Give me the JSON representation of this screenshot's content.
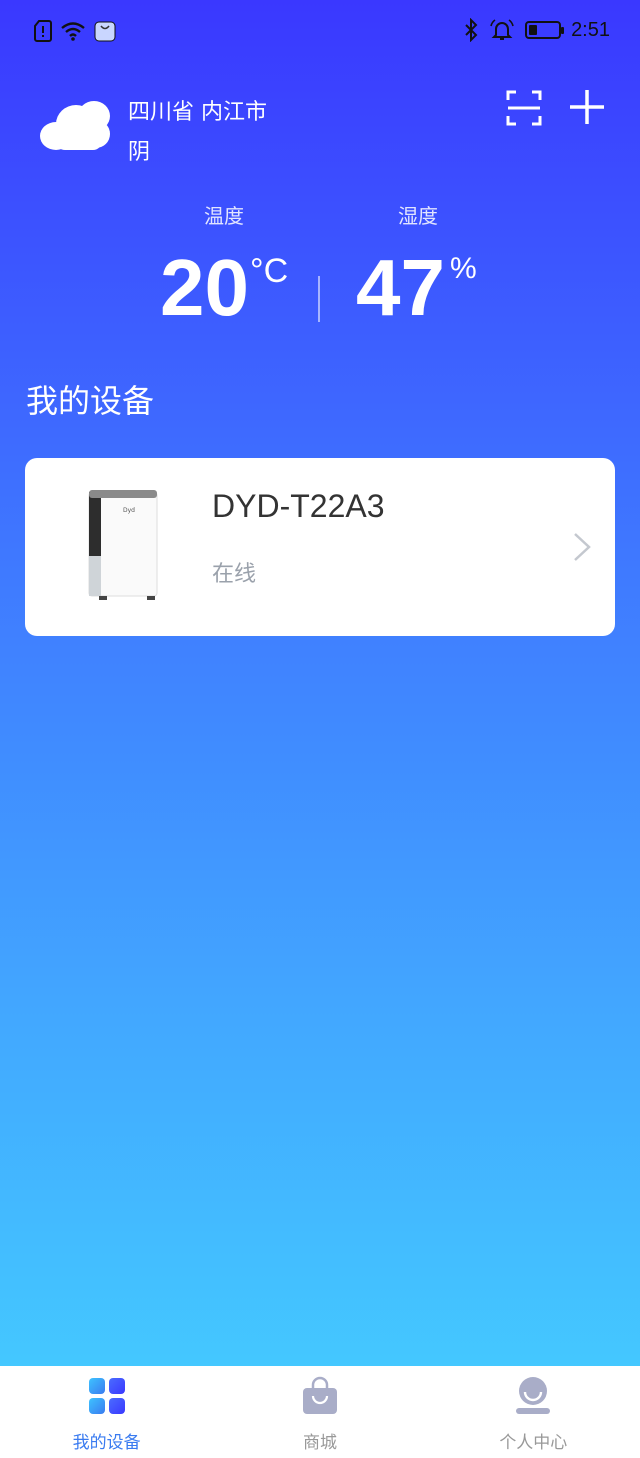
{
  "status_bar": {
    "time": "2:51",
    "battery_level": 0.3,
    "icons": [
      "sim-alert-icon",
      "wifi-icon",
      "notification-app-icon",
      "bluetooth-icon",
      "alarm-icon",
      "battery-icon"
    ]
  },
  "header": {
    "location": "四川省 内江市",
    "condition": "阴",
    "weather_icon": "cloud-icon",
    "actions": [
      "scan-icon",
      "add-icon"
    ]
  },
  "stats": {
    "temperature": {
      "label": "温度",
      "value": "20",
      "unit": "°C"
    },
    "humidity": {
      "label": "湿度",
      "value": "47",
      "unit": "%"
    }
  },
  "devices_section": {
    "title": "我的设备",
    "devices": [
      {
        "name": "DYD-T22A3",
        "status": "在线",
        "image": "dehumidifier-image"
      }
    ]
  },
  "bottom_nav": {
    "items": [
      {
        "label": "我的设备",
        "icon": "devices-grid-icon",
        "active": true
      },
      {
        "label": "商城",
        "icon": "shopping-bag-icon",
        "active": false
      },
      {
        "label": "个人中心",
        "icon": "profile-icon",
        "active": false
      }
    ]
  },
  "colors": {
    "gradient_top": "#3a38ff",
    "gradient_bottom": "#44d0ff",
    "active_nav": "#3a7bf0",
    "inactive_nav": "#999999"
  }
}
